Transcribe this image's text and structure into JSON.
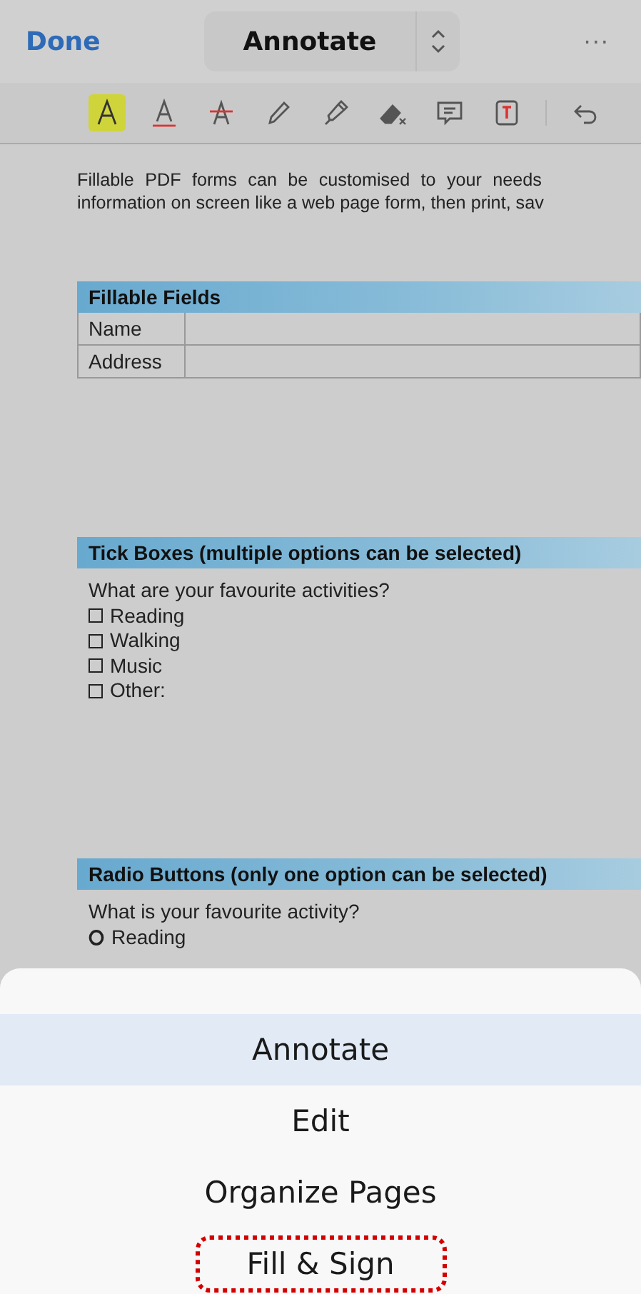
{
  "top_bar": {
    "done": "Done",
    "mode": "Annotate",
    "more": "···"
  },
  "tools": [
    {
      "kind": "highlight",
      "selected": true
    },
    {
      "kind": "underline",
      "selected": false
    },
    {
      "kind": "strikethrough",
      "selected": false
    },
    {
      "kind": "pencil",
      "selected": false
    },
    {
      "kind": "highlighter",
      "selected": false
    },
    {
      "kind": "eraser",
      "selected": false
    },
    {
      "kind": "comment",
      "selected": false
    },
    {
      "kind": "textbox",
      "selected": false
    },
    {
      "kind": "undo",
      "selected": false
    }
  ],
  "document": {
    "intro": [
      "Fillable PDF forms can be customised to your needs",
      "information on screen like a web page form, then print, sav"
    ],
    "sections": [
      {
        "kind": "table",
        "title": "Fillable Fields",
        "rows": [
          "Name",
          "Address"
        ]
      },
      {
        "kind": "checkboxes",
        "title": "Tick Boxes (multiple options can be selected)",
        "question": "What are your favourite activities?",
        "options": [
          {
            "label": "Reading",
            "checked": false
          },
          {
            "label": "Walking",
            "checked": false
          },
          {
            "label": "Music",
            "checked": false
          },
          {
            "label": "Other:",
            "checked": false
          }
        ]
      },
      {
        "kind": "radios",
        "title": "Radio Buttons (only one option can be selected)",
        "question": "What is your favourite activity?",
        "options": [
          {
            "label": "Reading",
            "checked": false
          }
        ]
      }
    ]
  },
  "mode_menu": [
    {
      "label": "Annotate",
      "selected": true,
      "highlighted": false
    },
    {
      "label": "Edit",
      "selected": false,
      "highlighted": false
    },
    {
      "label": "Organize Pages",
      "selected": false,
      "highlighted": false
    },
    {
      "label": "Fill & Sign",
      "selected": false,
      "highlighted": true
    }
  ]
}
